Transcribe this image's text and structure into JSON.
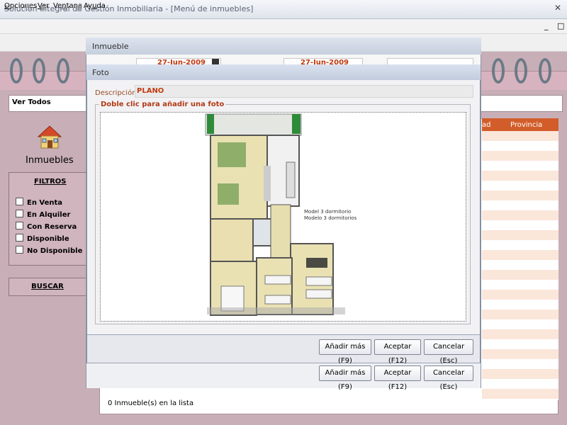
{
  "window": {
    "title": "Solución Integral de Gestión Inmobiliaria - [Menú de inmuebles]",
    "close_glyph": "✕"
  },
  "menu": [
    {
      "label": "Opciones",
      "u": "O",
      "rest": "pciones"
    },
    {
      "label": "Ver",
      "u": "V",
      "rest": "er"
    },
    {
      "label": "Ventana",
      "pre": "Ve",
      "u": "n",
      "rest": "tana"
    },
    {
      "label": "Ayuda",
      "pre": "Ay",
      "u": "u",
      "rest": "da"
    }
  ],
  "mdi_buttons": {
    "minimize": "_",
    "close": "□"
  },
  "sidebar": {
    "ver_todos": "Ver Todos",
    "section_title": "Inmuebles",
    "filters_title": "FILTROS",
    "filters": [
      "En Venta",
      "En Alquiler",
      "Con Reserva",
      "Disponible",
      "No Disponible"
    ],
    "search_button": "BUSCAR"
  },
  "list": {
    "columns": [
      "ad",
      "Provincia"
    ],
    "count_text": "0   Inmueble(s) en la lista"
  },
  "dialog_back": {
    "title": "Inmueble",
    "date1": "27-Jun-2009",
    "date2": "27-Jun-2009",
    "buttons": [
      "Añadir más (F9)",
      "Aceptar (F12)",
      "Cancelar (Esc)"
    ]
  },
  "dialog_front": {
    "title": "Foto",
    "description_label": "Descripción",
    "description_value": "PLANO",
    "group_label": "Doble clic para añadir una foto",
    "plan_text": [
      "Model 3 dormitorio",
      "Modelo 3 dormitorios"
    ],
    "buttons": [
      "Añadir más (F9)",
      "Aceptar (F12)",
      "Cancelar (Esc)"
    ]
  },
  "colors": {
    "accent": "#d25d2a",
    "background": "#c8aeb7",
    "list_stripe": "#fbe6da"
  }
}
